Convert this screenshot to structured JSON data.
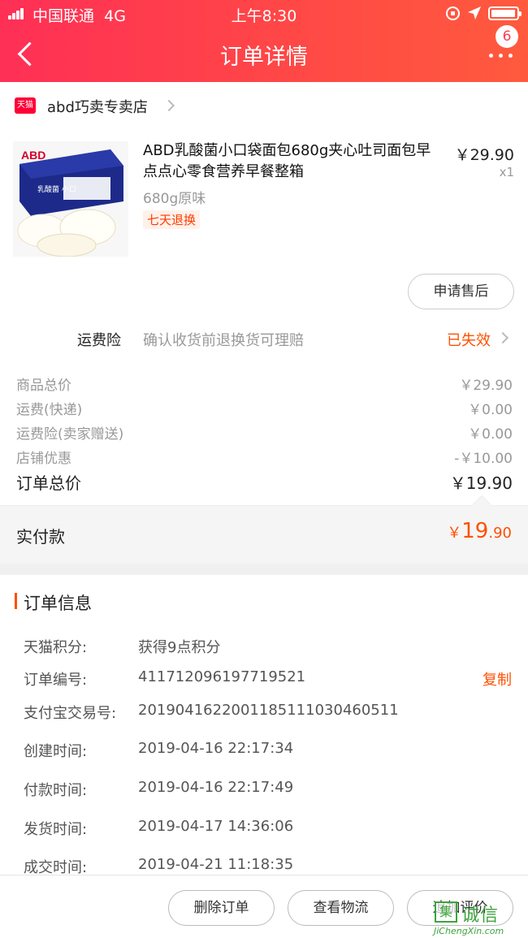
{
  "status_bar": {
    "carrier": "中国联通",
    "network": "4G",
    "time": "上午8:30"
  },
  "nav": {
    "title": "订单详情",
    "notification_count": "6"
  },
  "shop": {
    "logo_text": "天猫",
    "name": "abd巧卖专卖店"
  },
  "product": {
    "title": "ABD乳酸菌小口袋面包680g夹心吐司面包早点点心零食营养早餐整箱",
    "spec": "680g原味",
    "tag": "七天退换",
    "price": "￥29.90",
    "quantity": "x1",
    "image_brand": "ABD",
    "image_box_text": "乳酸菌 小口",
    "after_sale_label": "申请售后"
  },
  "insurance": {
    "label": "运费险",
    "description": "确认收货前退换货可理赔",
    "status": "已失效"
  },
  "fees": [
    {
      "label": "商品总价",
      "value": "￥29.90"
    },
    {
      "label": "运费(快递)",
      "value": "￥0.00"
    },
    {
      "label": "运费险(卖家赠送)",
      "value": "￥0.00"
    },
    {
      "label": "店铺优惠",
      "value": "-￥10.00"
    }
  ],
  "total": {
    "label": "订单总价",
    "value": "￥19.90"
  },
  "paid": {
    "label": "实付款",
    "currency": "￥",
    "integer": "19",
    "decimal": ".90"
  },
  "order_info": {
    "title": "订单信息",
    "copy_label": "复制",
    "rows": [
      {
        "key": "天猫积分:",
        "value": "获得9点积分"
      },
      {
        "key": "订单编号:",
        "value": "411712096197719521"
      },
      {
        "key": "支付宝交易号:",
        "value": "2019041622001185111030460511"
      },
      {
        "key": "创建时间:",
        "value": "2019-04-16 22:17:34"
      },
      {
        "key": "付款时间:",
        "value": "2019-04-16 22:17:49"
      },
      {
        "key": "发货时间:",
        "value": "2019-04-17 14:36:06"
      },
      {
        "key": "成交时间:",
        "value": "2019-04-21 11:18:35"
      }
    ]
  },
  "bottom_actions": {
    "delete_order": "删除订单",
    "view_logistics": "查看物流",
    "review": "追加评价"
  },
  "watermark": {
    "logo": "集",
    "text": "诚信",
    "url": "JiChengXin.com"
  },
  "colors": {
    "header_gradient_start": "#ff2f56",
    "header_gradient_end": "#ff5a3e",
    "accent_orange": "#ff5000",
    "tmall_red": "#ff0036",
    "watermark_green": "#3ea33e"
  }
}
